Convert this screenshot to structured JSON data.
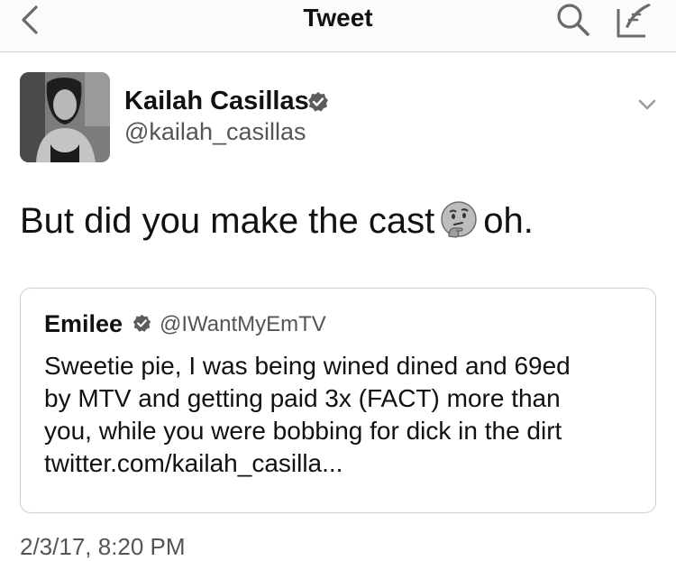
{
  "nav": {
    "title": "Tweet"
  },
  "tweet": {
    "author_name": "Kailah Casillas",
    "author_handle": "@kailah_casillas",
    "text_before": "But did you make the cast",
    "emoji": "thinking-face-icon",
    "text_after": "oh.",
    "timestamp": "2/3/17, 8:20 PM"
  },
  "quoted": {
    "name": "Emilee",
    "handle": "@IWantMyEmTV",
    "lines": [
      "Sweetie pie, I was being wined dined and 69ed",
      "by MTV and getting paid 3x (FACT) more than",
      "you, while you were bobbing for dick in the dirt",
      "twitter.com/kailah_casilla..."
    ]
  },
  "colors": {
    "text": "#111111",
    "secondary": "#555555",
    "border": "#cfcfcf",
    "verified": "#5c5c5c"
  }
}
